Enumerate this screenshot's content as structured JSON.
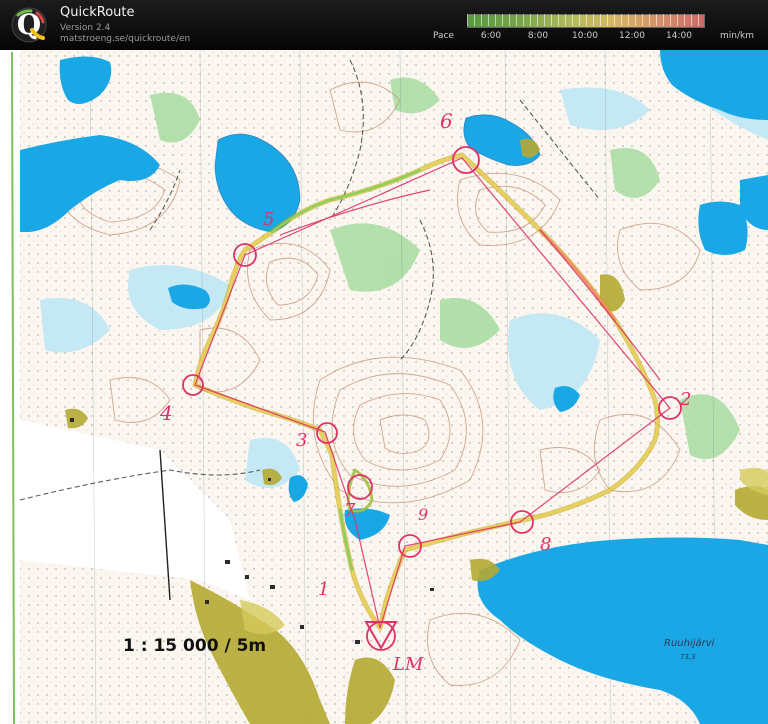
{
  "app": {
    "name": "QuickRoute",
    "version": "Version 2.4",
    "url": "matstroeng.se/quickroute/en",
    "logo_letter": "Q"
  },
  "pace_legend": {
    "label": "Pace",
    "unit": "min/km",
    "ticks": [
      "6:00",
      "8:00",
      "10:00",
      "12:00",
      "14:00"
    ],
    "min_pace_min": 5.2,
    "max_pace_min": 15.4
  },
  "map": {
    "scale": "1 : 15 000 / 5m",
    "lake_name": "Ruuhijärvi",
    "lake_height": "73,3",
    "colors": {
      "water": "#1aa7e6",
      "marsh": "#bfe7f3",
      "green": "#9fd89a",
      "yellow": "#a8a22a",
      "contour": "#c99a82",
      "course": "#e0306a",
      "route_base": "#c9a000"
    },
    "handwritten_labels": [
      "6",
      "5",
      "4",
      "3",
      "2",
      "1",
      "7",
      "8",
      "9",
      "LM"
    ]
  }
}
